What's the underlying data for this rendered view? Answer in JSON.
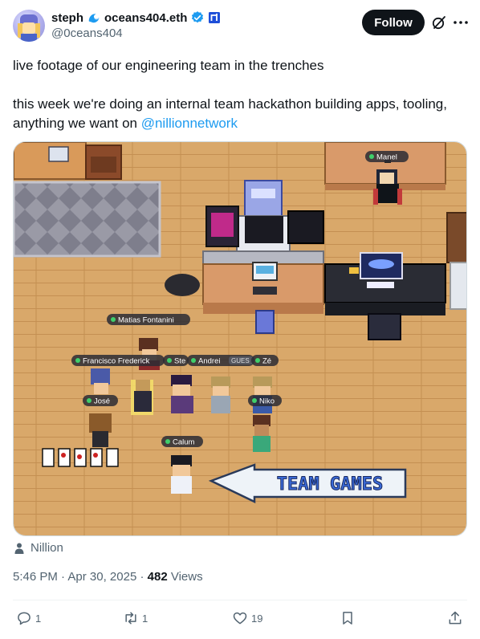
{
  "author": {
    "display_name": "steph",
    "display_suffix": "oceans404.eth",
    "handle": "@0ceans404",
    "icons": [
      "wave-icon",
      "verified-icon",
      "affiliate-badge-icon"
    ]
  },
  "header": {
    "follow_label": "Follow",
    "icons": [
      "grok-icon",
      "more-icon"
    ]
  },
  "tweet": {
    "line1": "live footage of our engineering team in the trenches",
    "line2_prefix": "this week we're doing an internal team hackathon building apps, tooling, anything we want on ",
    "mention": "@nillionnetwork"
  },
  "media": {
    "labels": {
      "manel": "Manel",
      "matias": "Matias Fontanini",
      "francisco": "Francisco Frederick",
      "ste": "Ste",
      "andrei": "Andrei",
      "guest": "GUES",
      "ze": "Zé",
      "jose": "José",
      "niko": "Niko",
      "calum": "Calum"
    },
    "sign_text": "TEAM GAMES"
  },
  "source": {
    "label": "Nillion"
  },
  "meta": {
    "time": "5:46 PM",
    "separator": " · ",
    "date": "Apr 30, 2025",
    "views_count": "482",
    "views_label": " Views"
  },
  "actions": {
    "replies": "1",
    "reposts": "1",
    "likes": "19"
  },
  "colors": {
    "accent": "#1d9bf0",
    "follow_bg": "#0f1419",
    "muted": "#536471"
  }
}
